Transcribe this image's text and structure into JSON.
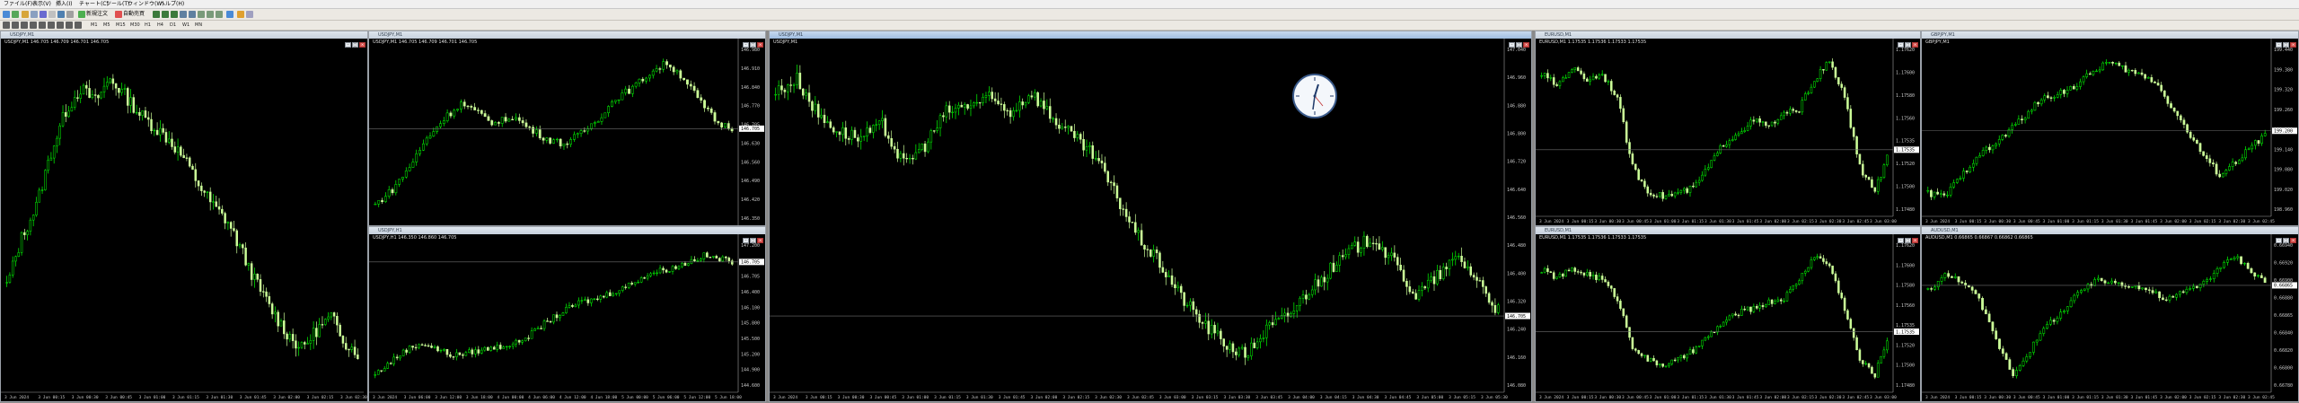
{
  "menu": [
    {
      "label": "ファイル(F)"
    },
    {
      "label": "表示(V)"
    },
    {
      "label": "挿入(I)"
    },
    {
      "label": "チャート(C)"
    },
    {
      "label": "ツール(T)"
    },
    {
      "label": "ウィンドウ(W)"
    },
    {
      "label": "ヘルプ(H)"
    }
  ],
  "toolbar": {
    "new_order_label": "新規注文",
    "auto_trading_label": "自動売買",
    "timeframes": [
      "M1",
      "M5",
      "M15",
      "M30",
      "H1",
      "H4",
      "D1",
      "W1",
      "MN"
    ]
  },
  "colors": {
    "bg": "#000000",
    "up": "#00ff00",
    "down": "#ccff99",
    "grid_line": "#6e6e6e"
  },
  "windows": [
    {
      "id": "w1",
      "title": "USDJPY,M1",
      "info": "USDJPY,M1  146.705 146.709 146.701 146.705",
      "time_labels": [
        "3 Jun 2024",
        "3 Jun 00:15",
        "3 Jun 00:30",
        "3 Jun 00:45",
        "3 Jun 01:00",
        "3 Jun 01:15",
        "3 Jun 01:30",
        "3 Jun 01:45",
        "3 Jun 02:00",
        "3 Jun 02:15",
        "3 Jun 02:30"
      ]
    },
    {
      "id": "w2",
      "title": "USDJPY,M1",
      "info": "USDJPY,M1  146.705 146.709 146.701 146.705",
      "price_labels": [
        "146.980",
        "146.910",
        "146.840",
        "146.770",
        "146.705",
        "146.630",
        "146.560",
        "146.490",
        "146.420",
        "146.350"
      ],
      "current_price": "146.705"
    },
    {
      "id": "w3",
      "title": "USDJPY,H1",
      "info": "USDJPY,H1  146.350 146.860 146.705",
      "price_labels": [
        "147.200",
        "146.900",
        "146.705",
        "146.400",
        "146.100",
        "145.800",
        "145.500",
        "145.200",
        "144.900",
        "144.600"
      ],
      "current_price": "146.705",
      "time_labels": [
        "3 Jun 2024",
        "3 Jun 06:00",
        "3 Jun 12:00",
        "3 Jun 18:00",
        "4 Jun 00:00",
        "4 Jun 06:00",
        "4 Jun 12:00",
        "4 Jun 18:00",
        "5 Jun 00:00",
        "5 Jun 06:00",
        "5 Jun 12:00",
        "5 Jun 18:00"
      ]
    },
    {
      "id": "w4",
      "title": "USDJPY,M1",
      "info": "USDJPY,M1",
      "price_labels": [
        "147.040",
        "146.960",
        "146.880",
        "146.800",
        "146.720",
        "146.640",
        "146.560",
        "146.480",
        "146.400",
        "146.320",
        "146.240",
        "146.160",
        "146.080"
      ],
      "current_price": "146.705",
      "time_labels": [
        "3 Jun 2024",
        "3 Jun 00:15",
        "3 Jun 00:30",
        "3 Jun 00:45",
        "3 Jun 01:00",
        "3 Jun 01:15",
        "3 Jun 01:30",
        "3 Jun 01:45",
        "3 Jun 02:00",
        "3 Jun 02:15",
        "3 Jun 02:30",
        "3 Jun 02:45",
        "3 Jun 03:00",
        "3 Jun 03:15",
        "3 Jun 03:30",
        "3 Jun 03:45",
        "3 Jun 04:00",
        "3 Jun 04:15",
        "3 Jun 04:30",
        "3 Jun 04:45",
        "3 Jun 05:00",
        "3 Jun 05:15",
        "3 Jun 05:30"
      ]
    },
    {
      "id": "w5",
      "title": "EURUSD,M1",
      "info": "EURUSD,M1  1.17535 1.17536 1.17533 1.17535",
      "price_labels": [
        "1.17620",
        "1.17600",
        "1.17580",
        "1.17560",
        "1.17535",
        "1.17520",
        "1.17500",
        "1.17480"
      ],
      "current_price": "1.17535",
      "time_labels": [
        "3 Jun 2024",
        "3 Jun 00:15",
        "3 Jun 00:30",
        "3 Jun 00:45",
        "3 Jun 01:00",
        "3 Jun 01:15",
        "3 Jun 01:30",
        "3 Jun 01:45",
        "3 Jun 02:00",
        "3 Jun 02:15",
        "3 Jun 02:30",
        "3 Jun 02:45",
        "3 Jun 03:00"
      ]
    },
    {
      "id": "w6",
      "title": "EURUSD,M1",
      "info": "EURUSD,M1  1.17535 1.17536 1.17533 1.17535",
      "price_labels": [
        "1.17620",
        "1.17600",
        "1.17580",
        "1.17560",
        "1.17535",
        "1.17520",
        "1.17500",
        "1.17480"
      ],
      "current_price": "1.17535",
      "time_labels": [
        "3 Jun 2024",
        "3 Jun 00:15",
        "3 Jun 00:30",
        "3 Jun 00:45",
        "3 Jun 01:00",
        "3 Jun 01:15",
        "3 Jun 01:30",
        "3 Jun 01:45",
        "3 Jun 02:00",
        "3 Jun 02:15",
        "3 Jun 02:30",
        "3 Jun 02:45",
        "3 Jun 03:00"
      ]
    },
    {
      "id": "w7",
      "title": "GBPJPY,M1",
      "info": "GBPJPY,M1",
      "price_labels": [
        "199.440",
        "199.380",
        "199.320",
        "199.260",
        "199.200",
        "199.140",
        "199.080",
        "199.020",
        "198.960"
      ],
      "current_price": "199.200",
      "time_labels": [
        "3 Jun 2024",
        "3 Jun 00:15",
        "3 Jun 00:30",
        "3 Jun 00:45",
        "3 Jun 01:00",
        "3 Jun 01:15",
        "3 Jun 01:30",
        "3 Jun 01:45",
        "3 Jun 02:00",
        "3 Jun 02:15",
        "3 Jun 02:30",
        "3 Jun 02:45"
      ]
    },
    {
      "id": "w8",
      "title": "AUDUSD,M1",
      "info": "AUDUSD,M1  0.66865 0.66867 0.66862 0.66865",
      "price_labels": [
        "0.66940",
        "0.66920",
        "0.66900",
        "0.66880",
        "0.66865",
        "0.66840",
        "0.66820",
        "0.66800",
        "0.66780"
      ],
      "current_price": "0.66865",
      "time_labels": [
        "3 Jun 2024",
        "3 Jun 00:15",
        "3 Jun 00:30",
        "3 Jun 00:45",
        "3 Jun 01:00",
        "3 Jun 01:15",
        "3 Jun 01:30",
        "3 Jun 01:45",
        "3 Jun 02:00",
        "3 Jun 02:15",
        "3 Jun 02:30",
        "3 Jun 02:45"
      ]
    }
  ],
  "chart_data": [
    {
      "type": "line",
      "series": [
        {
          "values": [
            146.3,
            146.45,
            146.55,
            146.72,
            146.85,
            146.92,
            146.88,
            146.95,
            146.9,
            146.84,
            146.8,
            146.76,
            146.7,
            146.62,
            146.55,
            146.5,
            146.4,
            146.3,
            146.22,
            146.15,
            146.1,
            146.16,
            146.2,
            146.12,
            146.08
          ]
        }
      ]
    },
    {
      "type": "line",
      "series": [
        {
          "values": [
            146.4,
            146.46,
            146.55,
            146.66,
            146.74,
            146.8,
            146.76,
            146.72,
            146.75,
            146.7,
            146.66,
            146.64,
            146.68,
            146.74,
            146.82,
            146.86,
            146.92,
            146.96,
            146.9,
            146.8,
            146.72,
            146.7
          ]
        }
      ]
    },
    {
      "type": "line",
      "series": [
        {
          "values": [
            144.9,
            145.1,
            145.3,
            145.4,
            145.3,
            145.2,
            145.25,
            145.3,
            145.35,
            145.4,
            145.55,
            145.75,
            145.9,
            146.05,
            146.1,
            146.2,
            146.3,
            146.45,
            146.55,
            146.6,
            146.7,
            146.8,
            146.75,
            146.7
          ]
        }
      ]
    },
    {
      "type": "line",
      "series": [
        {
          "values": [
            146.92,
            146.96,
            146.85,
            146.8,
            146.78,
            146.82,
            146.7,
            146.76,
            146.86,
            146.88,
            146.9,
            146.86,
            146.92,
            146.84,
            146.78,
            146.72,
            146.6,
            146.48,
            146.4,
            146.3,
            146.22,
            146.16,
            146.12,
            146.2,
            146.24,
            146.32,
            146.38,
            146.44,
            146.48,
            146.4,
            146.3,
            146.36,
            146.42,
            146.34,
            146.24
          ]
        }
      ]
    },
    {
      "type": "line",
      "series": [
        {
          "values": [
            1.176,
            1.1759,
            1.17605,
            1.17595,
            1.176,
            1.1758,
            1.1752,
            1.175,
            1.17495,
            1.17498,
            1.17502,
            1.1752,
            1.1754,
            1.1755,
            1.1756,
            1.17555,
            1.17565,
            1.1757,
            1.17595,
            1.1761,
            1.1758,
            1.1752,
            1.175,
            1.17535
          ]
        }
      ]
    },
    {
      "type": "line",
      "series": [
        {
          "values": [
            1.176,
            1.17592,
            1.176,
            1.17596,
            1.1759,
            1.1757,
            1.1752,
            1.17505,
            1.175,
            1.17505,
            1.17515,
            1.1753,
            1.17545,
            1.17555,
            1.1756,
            1.17566,
            1.1757,
            1.1759,
            1.17615,
            1.17605,
            1.1756,
            1.17505,
            1.1749,
            1.17535
          ]
        }
      ]
    },
    {
      "type": "line",
      "series": [
        {
          "values": [
            199.0,
            198.99,
            199.05,
            199.12,
            199.15,
            199.2,
            199.25,
            199.3,
            199.32,
            199.34,
            199.38,
            199.42,
            199.4,
            199.38,
            199.36,
            199.28,
            199.2,
            199.12,
            199.06,
            199.1,
            199.15,
            199.2
          ]
        }
      ]
    },
    {
      "type": "line",
      "series": [
        {
          "values": [
            0.6688,
            0.66895,
            0.6689,
            0.6687,
            0.6683,
            0.66795,
            0.6682,
            0.66845,
            0.6686,
            0.6688,
            0.6689,
            0.66888,
            0.66885,
            0.6688,
            0.6687,
            0.66878,
            0.66886,
            0.669,
            0.66915,
            0.669,
            0.66885
          ]
        }
      ]
    }
  ]
}
